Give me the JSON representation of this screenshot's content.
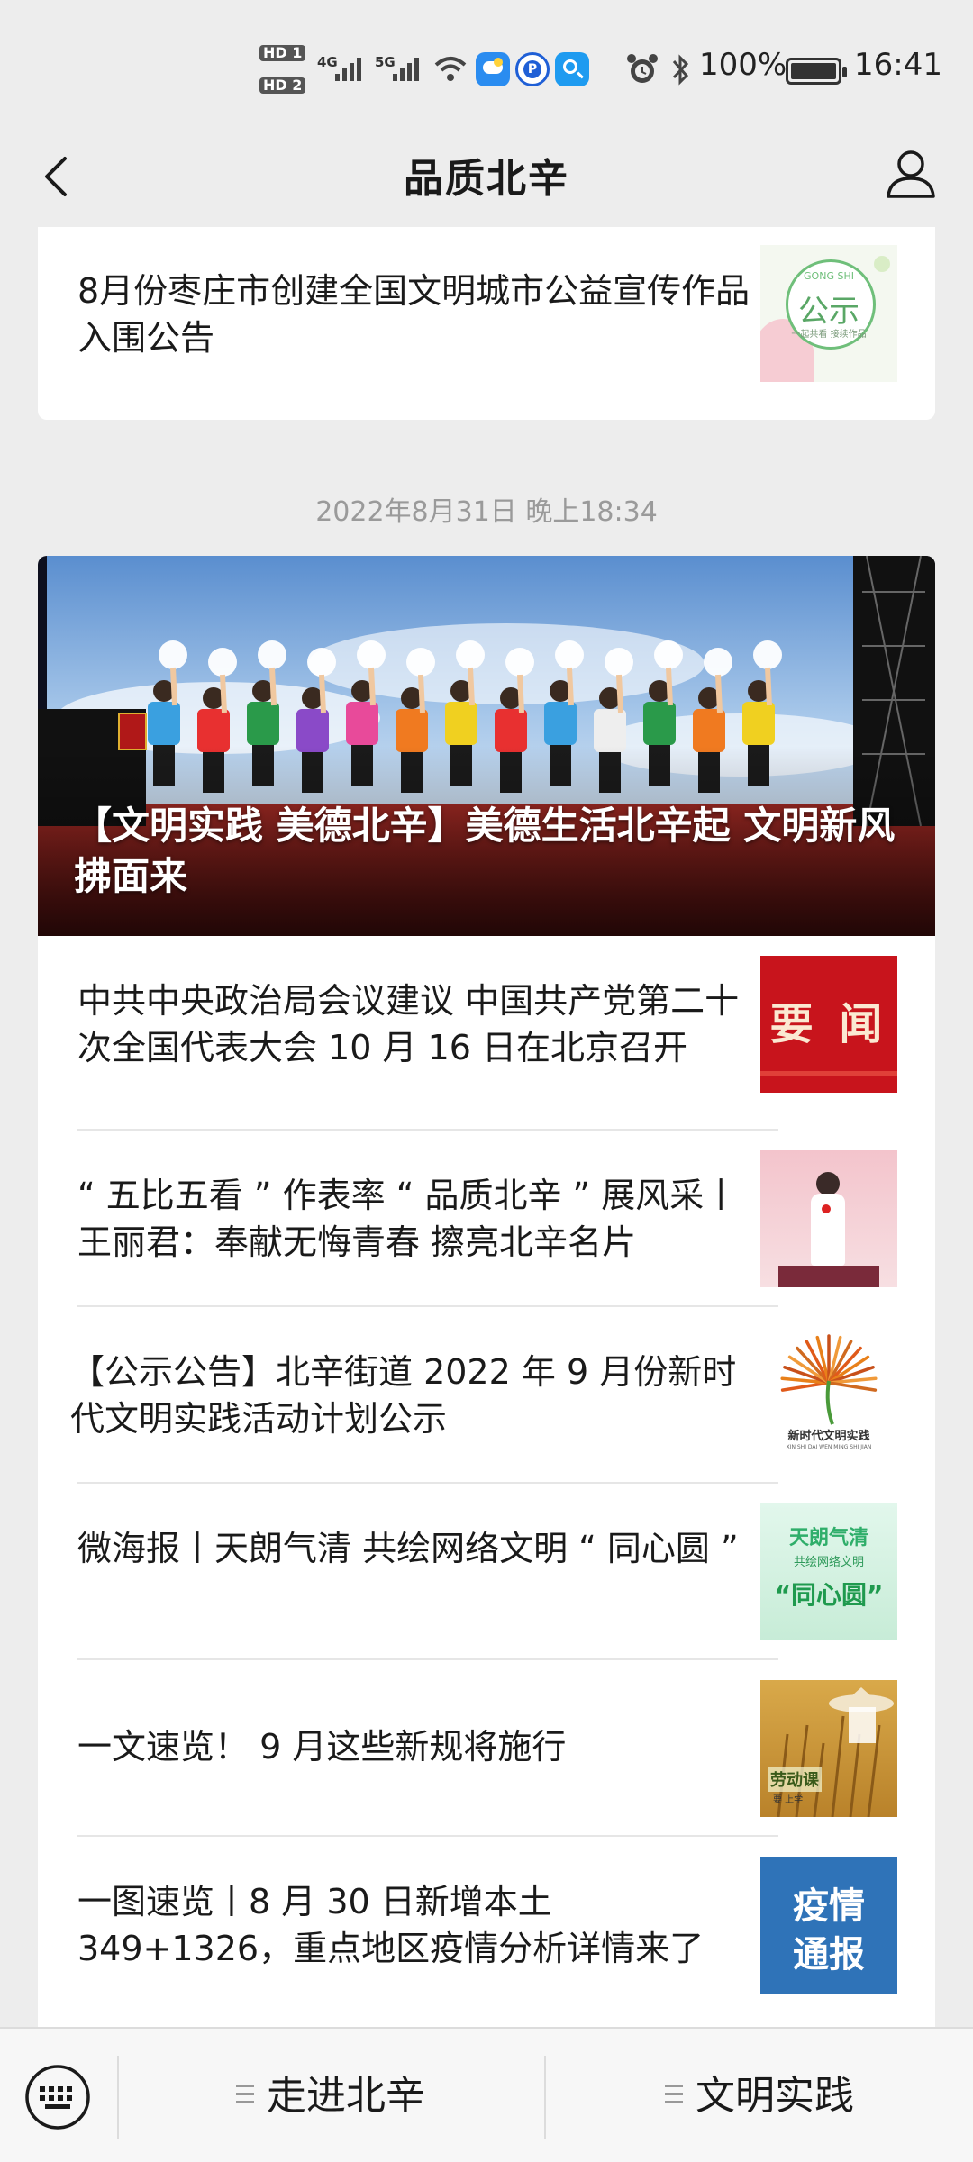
{
  "status_bar": {
    "hd1": "HD 1",
    "hd2": "HD 2",
    "net1": "4G",
    "net2": "5G",
    "battery_percent": "100%",
    "battery_level": 1.0,
    "time": "16:41"
  },
  "header": {
    "title": "品质北辛",
    "back_icon": "chevron-left-icon",
    "user_icon": "user-outline-icon"
  },
  "top_card": {
    "title": "8月份枣庄市创建全国文明城市公益宣传作品入围公告",
    "thumb_text_en": "GONG SHI",
    "thumb_text": "公示",
    "thumb_sub": "一起共看 接续作品"
  },
  "timestamp": "2022年8月31日 晚上18:34",
  "main_card": {
    "hero_title": "【文明实践 美德北辛】美德生活北辛起 文明新风拂面来",
    "items": [
      {
        "title": "中共中央政治局会议建议 中国共产党第二十次全国代表大会 10 月 16 日在北京召开",
        "thumb_text": "要 闻"
      },
      {
        "title": "“ 五比五看 ” 作表率 “ 品质北辛 ” 展风采丨王丽君：奉献无悔青春 擦亮北辛名片",
        "thumb_text": ""
      },
      {
        "title": "【公示公告】北辛街道 2022 年 9 月份新时代文明实践活动计划公示",
        "thumb_text": "新时代文明实践",
        "thumb_sub": "XIN SHI DAI WEN MING SHI JIAN"
      },
      {
        "title": "微海报丨天朗气清 共绘网络文明 “ 同心圆 ”",
        "thumb_line1": "天朗气清",
        "thumb_line2": "共绘网络文明",
        "thumb_line3": "“同心圆”"
      },
      {
        "title": "一文速览！ 9 月这些新规将施行",
        "thumb_text": "劳动课",
        "thumb_sub": "要  上学"
      },
      {
        "title": "一图速览丨8 月 30 日新增本土 349+1326，重点地区疫情分析详情来了",
        "thumb_line1": "疫情",
        "thumb_line2": "通报"
      }
    ]
  },
  "bottom_bar": {
    "keyboard_icon": "keyboard-icon",
    "menu1": "走进北辛",
    "menu2": "文明实践"
  },
  "colors": {
    "background": "#ededed",
    "card": "#ffffff",
    "timestamp": "#9a9a9a",
    "news_red": "#c8141c",
    "epidemic_blue": "#2f73b8"
  }
}
